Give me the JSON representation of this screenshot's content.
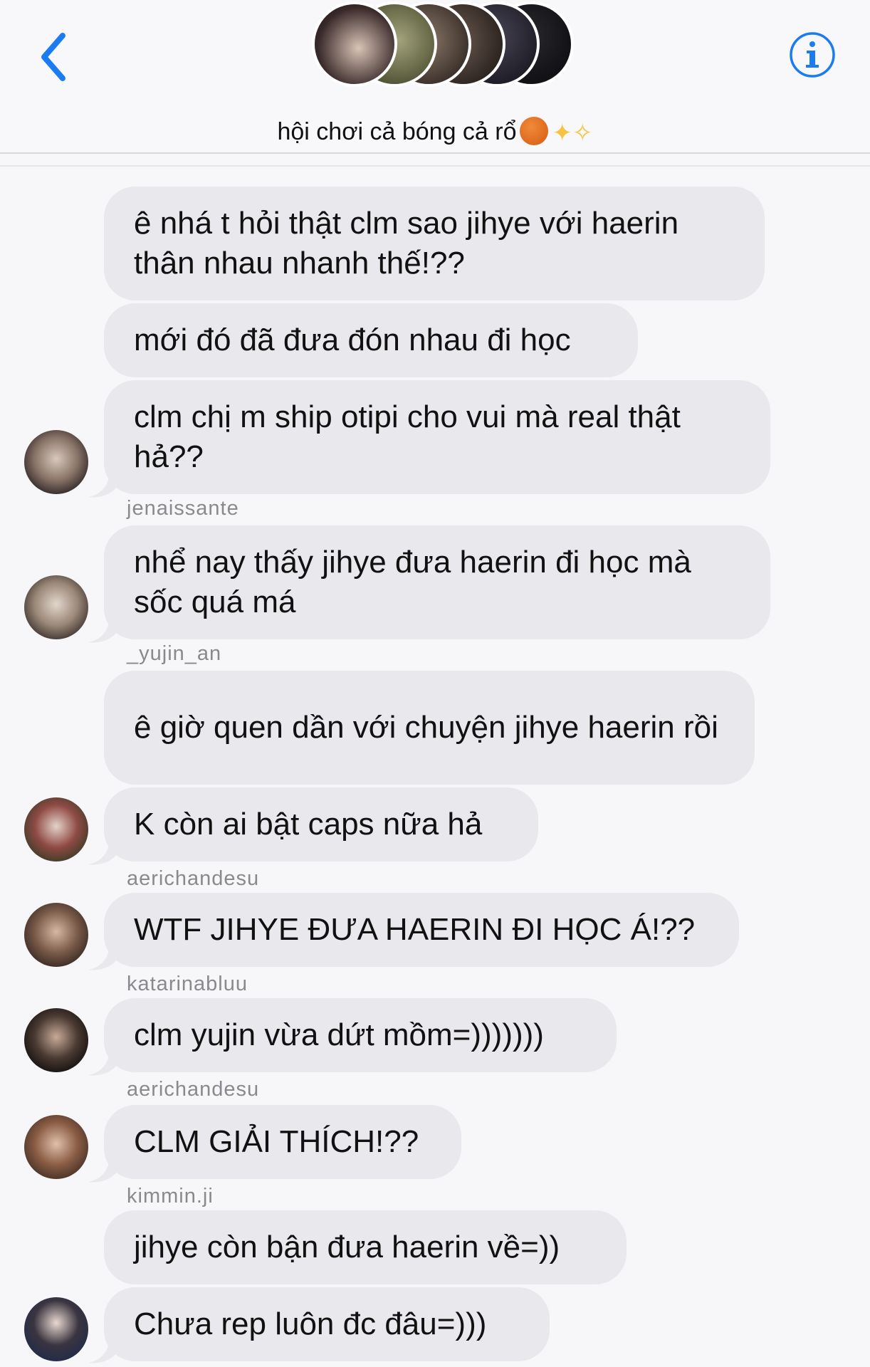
{
  "header": {
    "title": "hội chơi cả bóng cả rổ",
    "title_emoji_1": "basketball-emoji",
    "title_emoji_2": "sparkles-emoji",
    "back_icon": "chevron-left-icon",
    "info_icon": "info-icon",
    "accent_color": "#1a7cf0"
  },
  "messages": [
    {
      "text": "ê nhá t hỏi thật clm sao jihye với haerin thân nhau nhanh thế!??"
    },
    {
      "text": "mới đó đã đưa đón nhau đi học"
    },
    {
      "text": "clm chị m ship otipi cho vui mà real thật hả??"
    },
    {
      "sender": "jenaissante"
    },
    {
      "text": "nhể nay thấy jihye đưa haerin đi học mà sốc quá má"
    },
    {
      "sender": "_yujin_an"
    },
    {
      "text": "ê giờ quen dần với chuyện jihye haerin rồi"
    },
    {
      "text": "K còn ai bật caps nữa hả"
    },
    {
      "sender": "aerichandesu"
    },
    {
      "text": "WTF JIHYE ĐƯA HAERIN ĐI HỌC Á!??"
    },
    {
      "sender": "katarinabluu"
    },
    {
      "text": "clm yujin vừa dứt mồm=)))))))"
    },
    {
      "sender": "aerichandesu"
    },
    {
      "text": "CLM GIẢI THÍCH!??"
    },
    {
      "sender": "kimmin.ji"
    },
    {
      "text": "jihye còn bận đưa haerin về=))"
    },
    {
      "text": "Chưa rep luôn đc đâu=)))"
    }
  ],
  "bubble_color": "#e8e8ed",
  "sender_color": "#8a8a8e"
}
